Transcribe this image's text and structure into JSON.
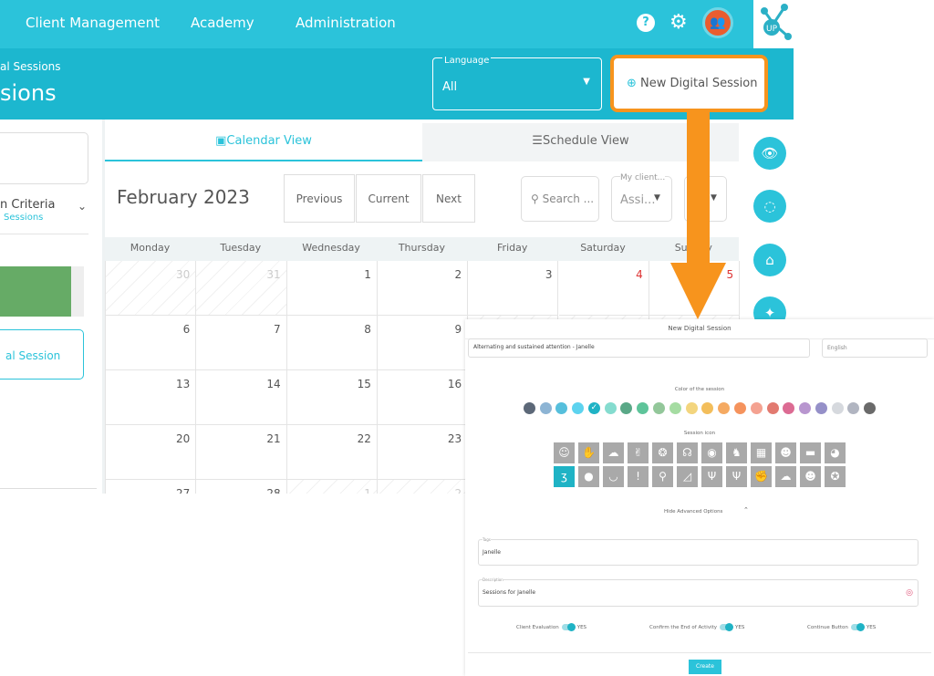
{
  "nav": {
    "items": [
      "Client Management",
      "Academy",
      "Administration"
    ]
  },
  "header": {
    "breadcrumb": "al Sessions",
    "title": "sions",
    "language_label": "Language",
    "language_value": "All",
    "new_session": "New Digital Session"
  },
  "left": {
    "criteria": "n Criteria",
    "criteria_sub": "Sessions",
    "session_btn": "al Session"
  },
  "tabs": {
    "calendar": "Calendar View",
    "schedule": "Schedule View"
  },
  "calendar": {
    "month": "February 2023",
    "previous": "Previous",
    "current": "Current",
    "next": "Next",
    "search_placeholder": "Search ...",
    "clients_label": "My client...",
    "clients_value": "Assi...",
    "days": [
      "Monday",
      "Tuesday",
      "Wednesday",
      "Thursday",
      "Friday",
      "Saturday",
      "Sunday"
    ],
    "rows": [
      [
        "30",
        "31",
        "1",
        "2",
        "3",
        "4",
        "5"
      ],
      [
        "6",
        "7",
        "8",
        "9",
        "",
        "",
        ""
      ],
      [
        "13",
        "14",
        "15",
        "16",
        "",
        "",
        ""
      ],
      [
        "20",
        "21",
        "22",
        "23",
        "",
        "",
        ""
      ],
      [
        "27",
        "28",
        "1",
        "2",
        "",
        "",
        ""
      ]
    ]
  },
  "modal": {
    "title": "New Digital Session",
    "name_value": "Alternating and sustained attention - Janelle",
    "language_value": "English",
    "color_label": "Color of the session",
    "colors": [
      "#5c6878",
      "#8db4d4",
      "#56bfdc",
      "#5dd3ef",
      "#1fb3c5",
      "#85dccf",
      "#5aa887",
      "#5ec49a",
      "#93c79a",
      "#a5dca2",
      "#f3d57e",
      "#f3be5b",
      "#f5aa62",
      "#f5935d",
      "#f4a291",
      "#e27a70",
      "#dc6b93",
      "#b896cf",
      "#9590c8",
      "#d6d9de",
      "#b1b5c1",
      "#6a6a6a"
    ],
    "selected_color": 4,
    "icon_label": "Session icon",
    "advanced": "Hide Advanced Options",
    "tags_label": "Tags",
    "tags_value": "Janelle",
    "desc_label": "Description",
    "desc_value": "Sessions for Janelle",
    "toggles": [
      {
        "label": "Client Evaluation",
        "value": "YES"
      },
      {
        "label": "Confirm the End of Activity",
        "value": "YES"
      },
      {
        "label": "Continue Button",
        "value": "YES"
      }
    ],
    "create": "Create"
  },
  "accent": "#2bc3da",
  "highlight": "#f7941d"
}
